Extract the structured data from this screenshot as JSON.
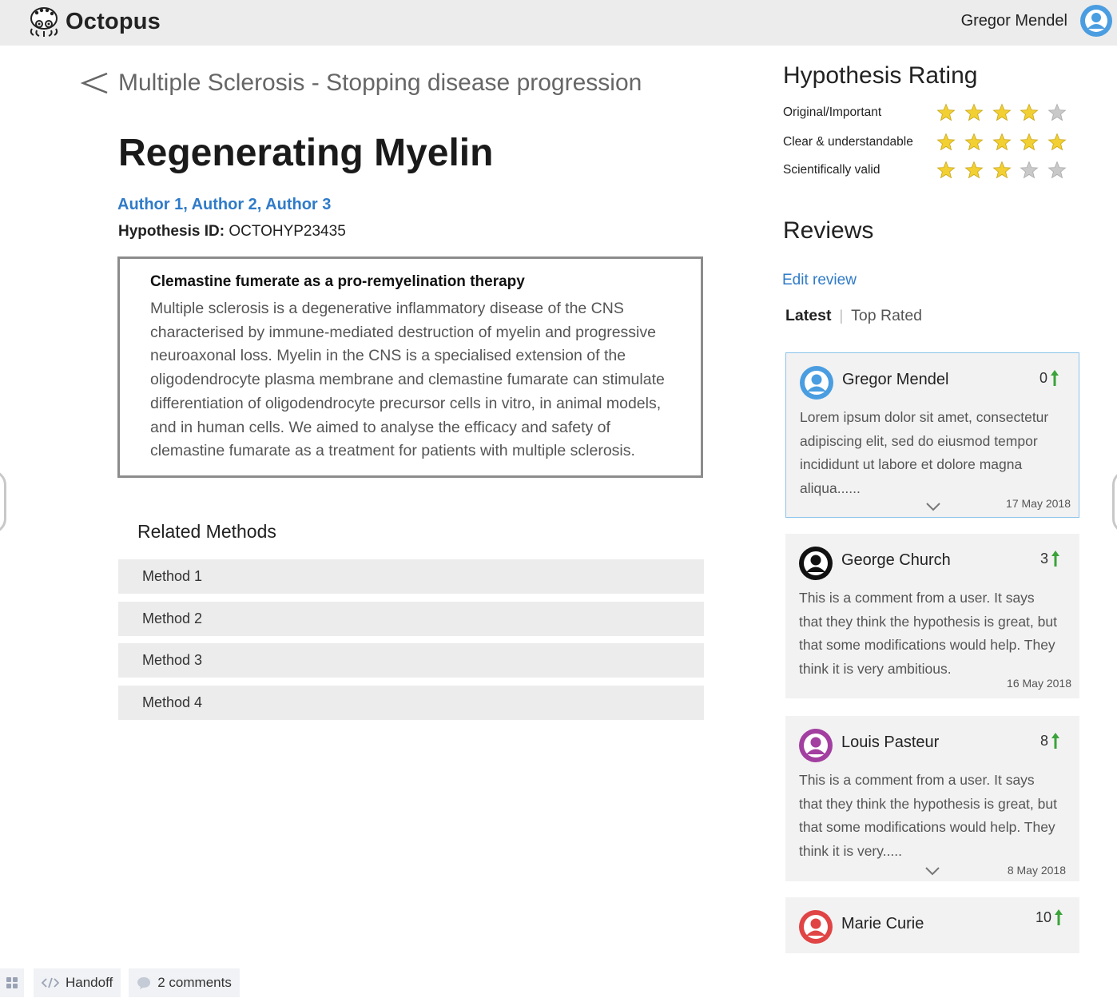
{
  "app": {
    "name": "Octopus",
    "logo_icon": "octopus-logo-icon"
  },
  "header": {
    "user_name": "Gregor Mendel",
    "avatar_icon": "user-avatar-icon"
  },
  "hypothesis": {
    "breadcrumb": "Multiple Sclerosis - Stopping disease progression",
    "title": "Regenerating Myelin",
    "authors": "Author 1, Author 2, Author 3",
    "id_label": "Hypothesis ID:",
    "id_value": "OCTOHYP23435",
    "abstract_title": "Clemastine fumerate as a pro-remyelination therapy",
    "abstract_lines": [
      "Multiple sclerosis is a degenerative inflammatory disease of the CNS",
      "characterised by immune-mediated destruction of myelin and progressive",
      "neuroaxonal loss. Myelin in the CNS is a specialised extension of the",
      "oligodendrocyte plasma membrane and clemastine fumarate can stimulate",
      "differentiation of oligodendrocyte precursor cells in vitro, in animal models,",
      "and in human cells. We aimed to analyse the efficacy and safety of",
      "clemastine fumarate as a treatment for patients with multiple sclerosis."
    ]
  },
  "related_methods": {
    "title": "Related Methods",
    "items": [
      "Method 1",
      "Method 2",
      "Method 3",
      "Method 4"
    ]
  },
  "rating": {
    "title": "Hypothesis Rating",
    "rows": [
      {
        "label": "Original/Important",
        "stars": 4,
        "max": 5
      },
      {
        "label": "Clear & understandable",
        "stars": 5,
        "max": 5
      },
      {
        "label": "Scientifically valid",
        "stars": 3,
        "max": 5
      }
    ],
    "star_color": "#f2d033",
    "empty_star_color": "#c9c9c9"
  },
  "reviews": {
    "title": "Reviews",
    "edit_label": "Edit review",
    "tabs": {
      "latest": "Latest",
      "separator": "|",
      "top_rated": "Top Rated"
    },
    "items": [
      {
        "name": "Gregor Mendel",
        "votes": "0",
        "avatar_color": "#4a9de0",
        "lines": [
          "Lorem ipsum dolor sit amet, consectetur",
          "adipiscing elit, sed do eiusmod tempor",
          "incididunt ut labore et dolore magna",
          "aliqua......"
        ],
        "date": "17 May 2018",
        "expandable": true,
        "active": true
      },
      {
        "name": "George Church",
        "votes": "3",
        "avatar_color": "#111111",
        "lines": [
          "This is a comment from a user. It says",
          "that they think the hypothesis is great, but",
          "that some modifications would help. They",
          "think it is very ambitious."
        ],
        "date": "16 May 2018",
        "expandable": false,
        "active": false
      },
      {
        "name": "Louis Pasteur",
        "votes": "8",
        "avatar_color": "#a23fa0",
        "lines": [
          "This is a comment from a user. It says",
          "that they think the hypothesis is great, but",
          "that some modifications would help. They",
          "think it is very....."
        ],
        "date": "8 May 2018",
        "expandable": true,
        "active": false
      },
      {
        "name": "Marie Curie",
        "votes": "10",
        "avatar_color": "#e04444",
        "lines": [],
        "date": "",
        "expandable": false,
        "active": false
      }
    ],
    "vote_arrow_color": "#3aa33a"
  },
  "toolbar": {
    "handoff_label": "Handoff",
    "comments_label": "2 comments"
  }
}
